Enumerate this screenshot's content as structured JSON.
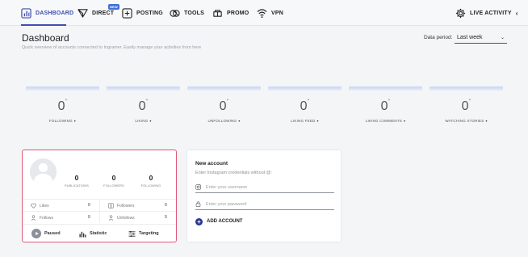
{
  "nav": {
    "items": [
      {
        "label": "DASHBOARD",
        "icon": "dashboard-icon"
      },
      {
        "label": "DIRECT",
        "icon": "send-icon",
        "badge": "NEW"
      },
      {
        "label": "POSTING",
        "icon": "add-post-icon"
      },
      {
        "label": "TOOLS",
        "icon": "tools-icon"
      },
      {
        "label": "PROMO",
        "icon": "promo-icon"
      },
      {
        "label": "VPN",
        "icon": "wifi-icon"
      }
    ],
    "live_activity": "LIVE ACTIVITY",
    "live_chevron": "‹",
    "accent_color": "#3f4fb0"
  },
  "header": {
    "title": "Dashboard",
    "subtitle": "Quick overview of accounts connected to Ingramer. Easily manage your activities from here",
    "period_label": "Data period:",
    "period_value": "Last week"
  },
  "stats": [
    {
      "value": "0",
      "plus": "+",
      "label": "FOLLOWING",
      "arrow": "▾"
    },
    {
      "value": "0",
      "plus": "+",
      "label": "LIKING",
      "arrow": "▾"
    },
    {
      "value": "0",
      "plus": "+",
      "label": "UNFOLLOWING",
      "arrow": "▾"
    },
    {
      "value": "0",
      "plus": "+",
      "label": "LIKING FEED",
      "arrow": "▾"
    },
    {
      "value": "0",
      "plus": "+",
      "label": "LIKING COMMENTS",
      "arrow": "▾"
    },
    {
      "value": "0",
      "plus": "+",
      "label": "WATCHING STORIES",
      "arrow": "▾"
    }
  ],
  "account": {
    "publications": "0",
    "publications_label": "PUBLICATIONS",
    "followers": "0",
    "followers_label": "FOLLOWERS",
    "following": "0",
    "following_label": "FOLLOWING",
    "likes_label": "Likes",
    "likes": "0",
    "followers_row_label": "Followers",
    "followers_row": "0",
    "follows_label": "Follows",
    "follows": "0",
    "unfollows_label": "Unfollows",
    "unfollows": "0",
    "paused_label": "Paused",
    "statistic_label": "Statistic",
    "targeting_label": "Targeting",
    "border_color": "#e05a78"
  },
  "new_account": {
    "title": "New account",
    "subtitle": "Enter Instagram credentials without @:",
    "username_placeholder": "Enter your username",
    "password_placeholder": "Enter your password",
    "add_label": "ADD ACCOUNT"
  }
}
